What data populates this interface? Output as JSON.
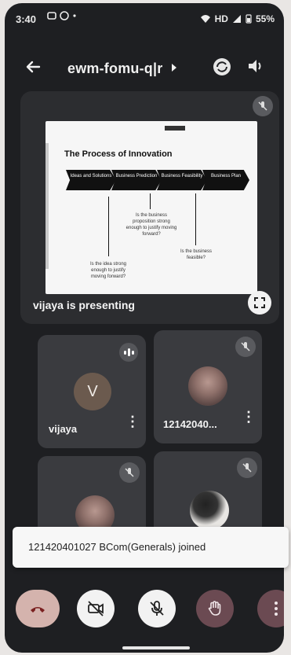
{
  "status_bar": {
    "time": "3:40",
    "network_label": "HD",
    "battery": "55%"
  },
  "header": {
    "meeting_code": "ewm-fomu-q|r",
    "icons": [
      "back-arrow-icon",
      "switch-camera-icon",
      "speaker-icon"
    ]
  },
  "presentation": {
    "presenting_label": "vijaya is presenting",
    "slide": {
      "title": "The Process of Innovation",
      "steps": [
        "Ideas and Solutions",
        "Business Prediction",
        "Business Feasibility",
        "Business Plan"
      ],
      "notes": [
        "Is the idea strong enough to justify moving forward?",
        "Is the business proposition strong enough to justify moving forward?",
        "Is the business feasible?"
      ]
    }
  },
  "participants": [
    {
      "name": "vijaya",
      "initial": "V",
      "speaking": true,
      "muted": false
    },
    {
      "name": "12142040...",
      "initial": "",
      "speaking": false,
      "muted": true
    },
    {
      "name": "",
      "initial": "",
      "speaking": false,
      "muted": true
    },
    {
      "name": "",
      "initial": "",
      "speaking": false,
      "muted": true
    }
  ],
  "toast": {
    "message": "121420401027 BCom(Generals) joined"
  },
  "controls": {
    "accent_end_call": "#d4b3ad",
    "accent_raise_hand": "#6b4a52",
    "icons": [
      "end-call-icon",
      "camera-off-icon",
      "mic-off-icon",
      "raise-hand-icon",
      "more-options-icon"
    ]
  }
}
